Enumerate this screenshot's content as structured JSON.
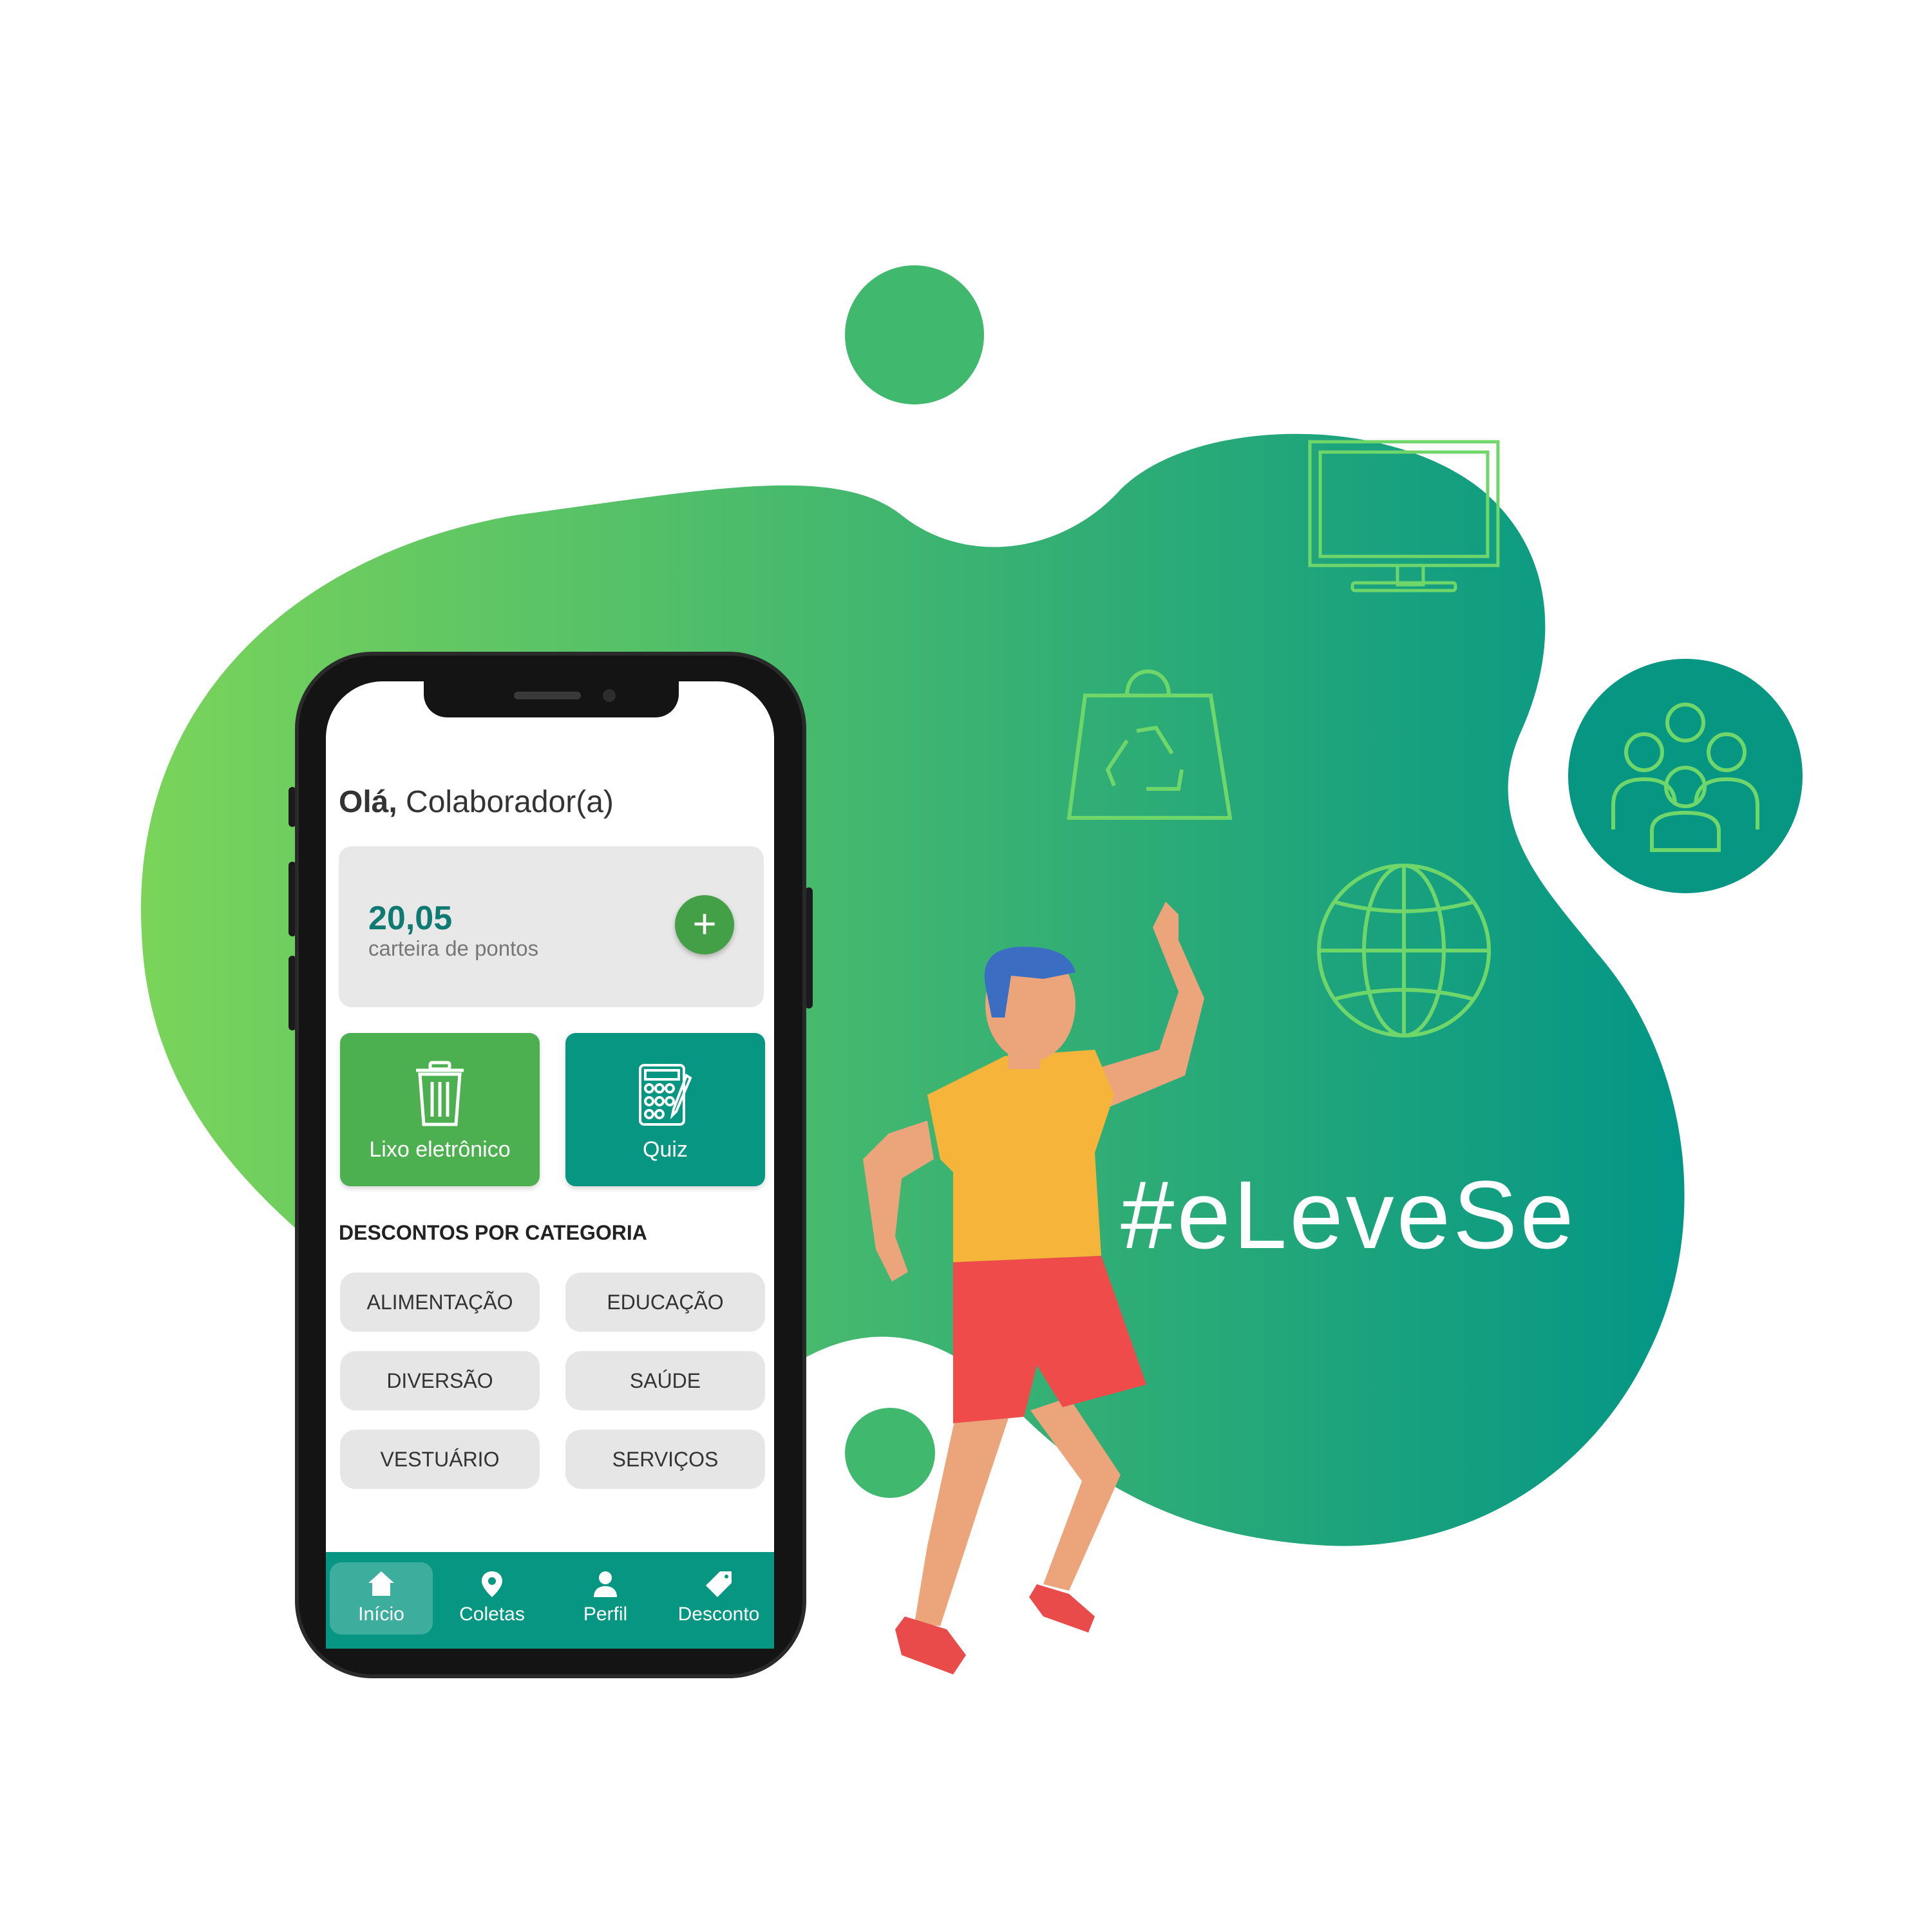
{
  "colors": {
    "blob_start": "#7ad45a",
    "blob_end": "#039686",
    "accent_green": "#43a047",
    "teal": "#079682",
    "outline_icon_green": "#6fd66a"
  },
  "icons": [
    "tv-icon",
    "recycle-bag-icon",
    "globe-icon",
    "people-group-icon",
    "trash-icon",
    "quiz-icon",
    "home-icon",
    "location-pin-icon",
    "user-icon",
    "tag-icon",
    "plus-icon"
  ],
  "app": {
    "greeting_hi": "Olá,",
    "greeting_name": " Colaborador(a)",
    "points": {
      "value": "20,05",
      "label": "carteira de pontos",
      "add_symbol": "+"
    },
    "tiles": [
      {
        "label": "Lixo eletrônico",
        "color": "#4caf50"
      },
      {
        "label": "Quiz",
        "color": "#079682"
      }
    ],
    "discounts": {
      "title": "DESCONTOS POR CATEGORIA",
      "categories": [
        "ALIMENTAÇÃO",
        "EDUCAÇÃO",
        "DIVERSÃO",
        "SAÚDE",
        "VESTUÁRIO",
        "SERVIÇOS"
      ]
    },
    "nav": [
      {
        "label": "Início",
        "active": true
      },
      {
        "label": "Coletas",
        "active": false
      },
      {
        "label": "Perfil",
        "active": false
      },
      {
        "label": "Desconto",
        "active": false
      }
    ]
  },
  "hashtag": "#eLeveSe"
}
